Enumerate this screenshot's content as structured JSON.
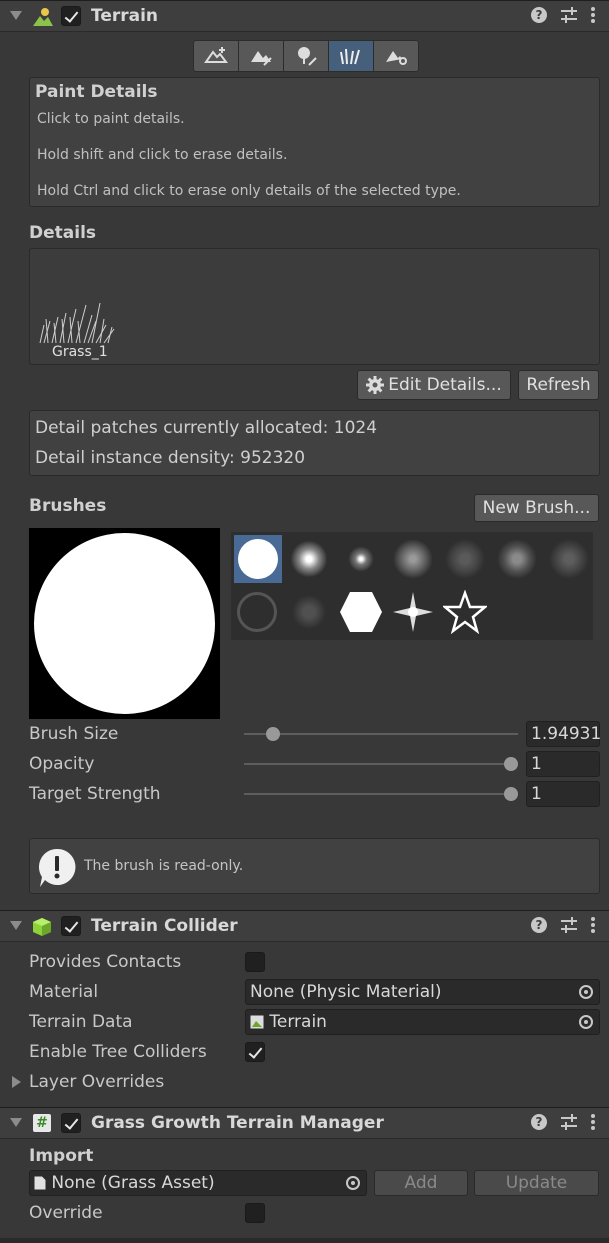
{
  "terrain": {
    "title": "Terrain",
    "enabled": true,
    "tools": [
      "create-neighbor-icon",
      "paint-terrain-icon",
      "paint-trees-icon",
      "paint-details-icon",
      "terrain-settings-icon"
    ],
    "active_tool": 3,
    "paint_details": {
      "heading": "Paint Details",
      "line1": "Click to paint details.",
      "line2": "Hold shift and click to erase details.",
      "line3": "Hold Ctrl and click to erase only details of the selected type."
    },
    "details": {
      "heading": "Details",
      "item_label": "Grass_1",
      "edit_button": "Edit Details...",
      "refresh_button": "Refresh"
    },
    "stats": {
      "allocated": "Detail patches currently allocated: 1024",
      "density": "Detail instance density: 952320"
    },
    "brushes": {
      "heading": "Brushes",
      "new_brush_button": "New Brush..."
    },
    "brush_size": {
      "label": "Brush Size",
      "value": "1.94931",
      "fraction": 0.1
    },
    "opacity": {
      "label": "Opacity",
      "value": "1",
      "fraction": 1.0
    },
    "target_strength": {
      "label": "Target Strength",
      "value": "1",
      "fraction": 1.0
    },
    "readonly_message": "The brush is read-only."
  },
  "collider": {
    "title": "Terrain Collider",
    "enabled": true,
    "provides_contacts": {
      "label": "Provides Contacts",
      "checked": false
    },
    "material": {
      "label": "Material",
      "value": "None (Physic Material)"
    },
    "terrain_data": {
      "label": "Terrain Data",
      "value": "Terrain"
    },
    "tree_colliders": {
      "label": "Enable Tree Colliders",
      "checked": true
    },
    "layer_overrides": "Layer Overrides"
  },
  "grass": {
    "title": "Grass Growth Terrain Manager",
    "enabled": true,
    "import_heading": "Import",
    "asset": "None (Grass Asset)",
    "add_button": "Add",
    "update_button": "Update",
    "override_label": "Override",
    "override_checked": false
  },
  "colors": {
    "panel_bg": "#383838",
    "header_bg": "#3e3e3e",
    "active_tool": "#46607c",
    "selected_brush": "#4a6a96"
  }
}
